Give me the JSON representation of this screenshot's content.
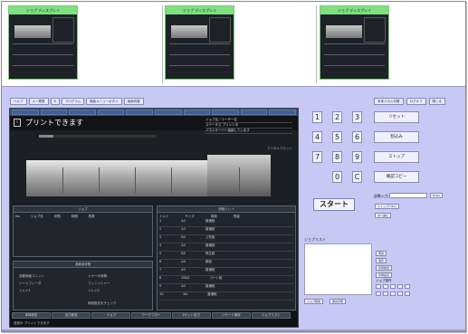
{
  "thumbnails": {
    "items": [
      {
        "title": "ジョブ ディスプレイ"
      },
      {
        "title": "ジョブ ディスプレイ"
      },
      {
        "title": "ジョブ ディスプレイ"
      }
    ]
  },
  "top_buttons_left": [
    "ヘルプ",
    "キー履歴",
    "8",
    "プログラム",
    "機能メニューボタン",
    "画面切替"
  ],
  "top_buttons_right": [
    "本体パネル切替",
    "ログオフ",
    "閉じる"
  ],
  "screen": {
    "title": "プリントできます",
    "info_lines": [
      "ジョブ名／ユーザー名",
      "ステータス  プリント中",
      "パネルサーバー接続しています"
    ],
    "message": "デジタルアセット",
    "progress": 0.12,
    "left_top_panel": {
      "title": "ジョブ",
      "columns": [
        "No",
        "ジョブ名",
        "状態",
        "時間",
        "枚数"
      ]
    },
    "left_bottom_panel": {
      "title": "消耗品状態",
      "items": [
        "自動両面ユニット",
        "トナーの消費",
        "シートフィーダ",
        "フィニッシャー",
        "トレイ1",
        "トレイ2"
      ],
      "check_label": "用紙設定をチェック"
    },
    "right_panel": {
      "title": "用紙トレイ",
      "columns": [
        "トレイ",
        "サイズ",
        "用紙",
        "残量"
      ],
      "rows": [
        {
          "tray": "1",
          "size": "A4",
          "type": "普通紙"
        },
        {
          "tray": "2",
          "size": "A3",
          "type": "普通紙"
        },
        {
          "tray": "3",
          "size": "B4",
          "type": "上質紙"
        },
        {
          "tray": "4",
          "size": "A4",
          "type": "普通紙"
        },
        {
          "tray": "5",
          "size": "B5",
          "type": "再生紙"
        },
        {
          "tray": "6",
          "size": "A4",
          "type": "厚紙"
        },
        {
          "tray": "7",
          "size": "A3",
          "type": "普通紙"
        },
        {
          "tray": "8",
          "size": "SRA3",
          "type": "コート紙"
        },
        {
          "tray": "9",
          "size": "A4",
          "type": "普通紙"
        },
        {
          "tray": "10",
          "size": "B4",
          "type": "普通紙"
        }
      ]
    },
    "tabs": [
      "本体設定",
      "出力設定",
      "ジョブ",
      "ワークフロー",
      "1セット出力",
      "リモート保存",
      "ジョブリスト"
    ],
    "footer_status": "送信中  プリントできます"
  },
  "keypad": {
    "keys": [
      "1",
      "2",
      "3",
      "4",
      "5",
      "6",
      "7",
      "8",
      "9",
      "0",
      "C"
    ],
    "functions": [
      "リセット",
      "割込み",
      "ストップ",
      "確認コピー"
    ]
  },
  "start_label": "スタート",
  "number_input": {
    "label": "部数入力",
    "button": "Enter"
  },
  "small_buttons": [
    "ストップパネル",
    "次へ進む"
  ],
  "job_list": {
    "label": "ジョブリスト",
    "buttons": [
      "ジョブ削除",
      "優先印刷"
    ]
  },
  "side_buttons": [
    "再送",
    "保存",
    "状態確認",
    "印刷設定"
  ],
  "side_label": "ジョブ操作"
}
